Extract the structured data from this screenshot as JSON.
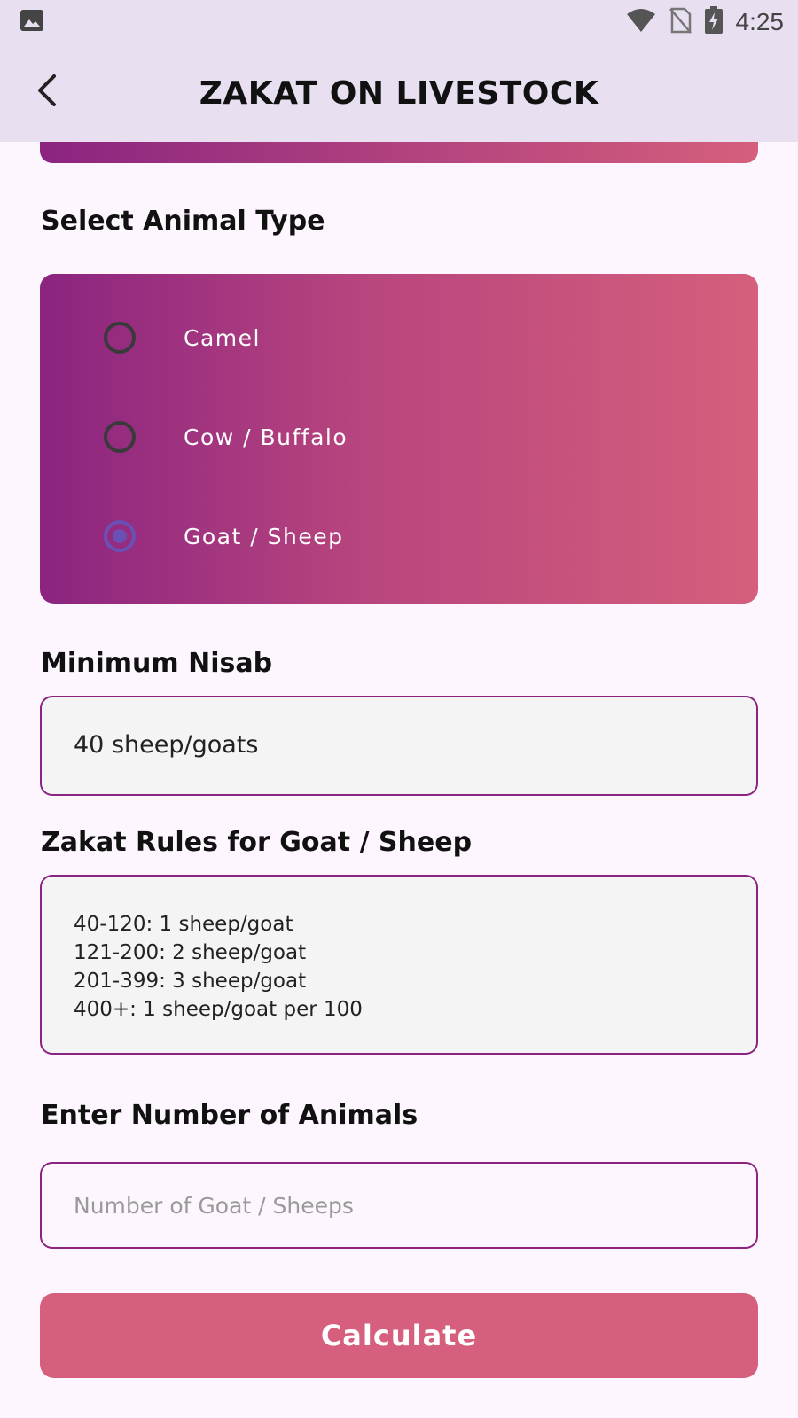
{
  "status_bar": {
    "time": "4:25",
    "icons": [
      "image-icon",
      "wifi-icon",
      "no-sim-icon",
      "battery-charging-icon"
    ]
  },
  "app_bar": {
    "title": "ZAKAT ON LIVESTOCK",
    "back_icon": "back-arrow-icon"
  },
  "animal_type": {
    "label": "Select Animal Type",
    "options": [
      {
        "label": "Camel",
        "selected": false
      },
      {
        "label": "Cow / Buffalo",
        "selected": false
      },
      {
        "label": "Goat / Sheep",
        "selected": true
      }
    ]
  },
  "nisab": {
    "label": "Minimum Nisab",
    "value": "40 sheep/goats"
  },
  "rules": {
    "label": "Zakat Rules for Goat / Sheep",
    "lines": [
      "40-120: 1 sheep/goat",
      "121-200: 2 sheep/goat",
      "201-399: 3 sheep/goat",
      "400+: 1 sheep/goat per 100"
    ]
  },
  "animals_input": {
    "label": "Enter Number of Animals",
    "placeholder": "Number of Goat / Sheeps",
    "value": ""
  },
  "calculate_button": {
    "label": "Calculate"
  },
  "colors": {
    "gradient_start": "#8b2480",
    "gradient_end": "#d55f7c",
    "button": "#d55f7c",
    "border": "#8b2480",
    "app_bar": "#e8e0f0",
    "background": "#fdf6fe"
  }
}
